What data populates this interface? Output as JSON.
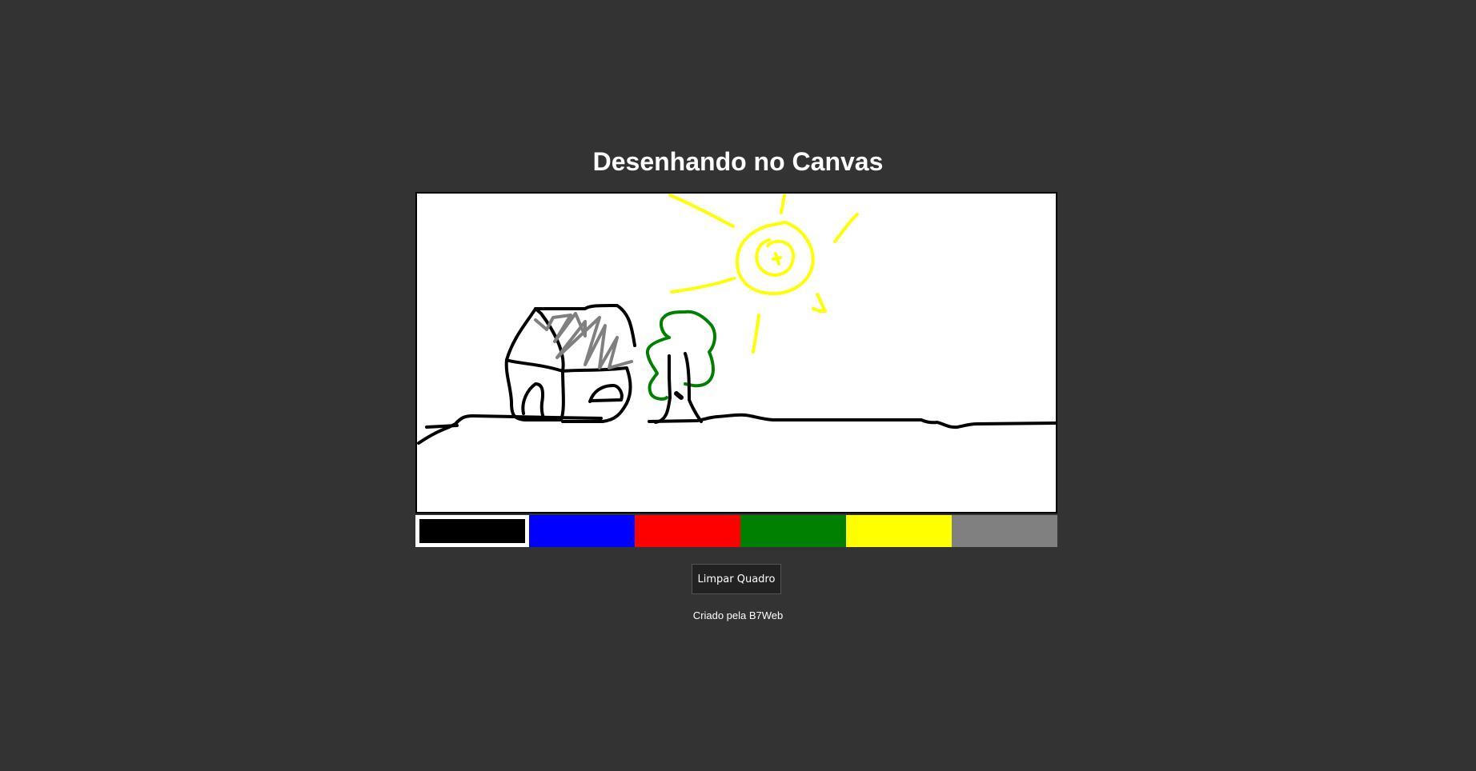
{
  "page": {
    "title": "Desenhando no Canvas",
    "footer": "Criado pela B7Web"
  },
  "toolbar": {
    "clear_label": "Limpar Quadro"
  },
  "palette": {
    "colors": [
      {
        "name": "black",
        "hex": "#000000",
        "selected": true
      },
      {
        "name": "blue",
        "hex": "#0000ff",
        "selected": false
      },
      {
        "name": "red",
        "hex": "#ff0000",
        "selected": false
      },
      {
        "name": "green",
        "hex": "#008000",
        "selected": false
      },
      {
        "name": "yellow",
        "hex": "#ffff00",
        "selected": false
      },
      {
        "name": "gray",
        "hex": "#808080",
        "selected": false
      }
    ]
  },
  "canvas": {
    "background": "#ffffff",
    "drawing": "house, tree and sun sketch"
  }
}
